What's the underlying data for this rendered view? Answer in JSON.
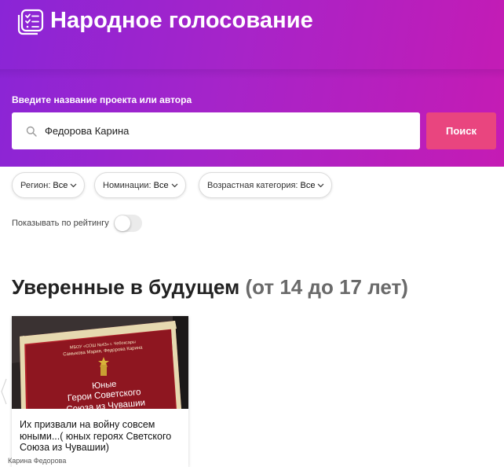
{
  "header": {
    "title": "Народное голосование",
    "logo_icon": "ballot-list-icon",
    "gradient_colors": [
      "#8a25d6",
      "#c51bb4"
    ]
  },
  "search": {
    "label": "Введите название проекта или автора",
    "value": "Федорова Карина",
    "button_label": "Поиск",
    "button_color": "#e9457f"
  },
  "filters": [
    {
      "label": "Регион:",
      "value": "Все"
    },
    {
      "label": "Номинации:",
      "value": "Все"
    },
    {
      "label": "Возрастная категория:",
      "value": "Все"
    }
  ],
  "rating_toggle": {
    "label": "Показывать по рейтингу",
    "enabled": false
  },
  "section": {
    "title": "Уверенные в будущем",
    "subtitle": "(от 14 до 17 лет)"
  },
  "cards": [
    {
      "image_caption_line1": "МБОУ «СОШ №43» г. Чебоксары",
      "image_caption_line2": "Самыкова Мария, Федорова Карина",
      "image_heading_line1": "Юные",
      "image_heading_line2": "Герои Советского",
      "image_heading_line3": "Союза из Чувашии",
      "title": "Их призвали на войну совсем юными...( юных героях Светского Союза из Чувашии)",
      "author": "Карина Федорова"
    }
  ]
}
